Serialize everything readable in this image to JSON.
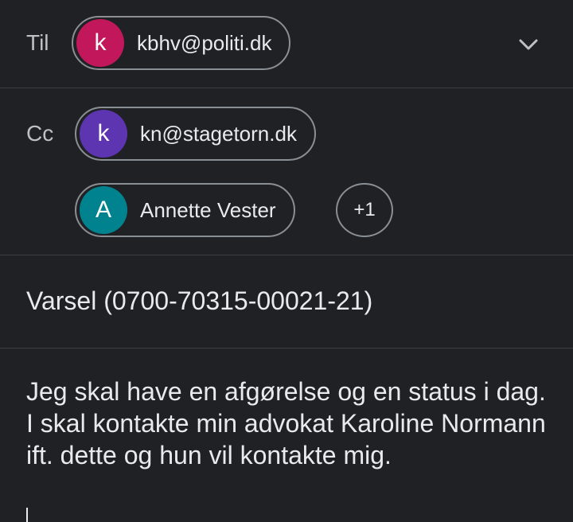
{
  "to": {
    "label": "Til",
    "recipients": [
      {
        "initial": "k",
        "text": "kbhv@politi.dk",
        "color": "#c2185b"
      }
    ]
  },
  "cc": {
    "label": "Cc",
    "recipients": [
      {
        "initial": "k",
        "text": "kn@stagetorn.dk",
        "color": "#5e35b1"
      },
      {
        "initial": "A",
        "text": "Annette Vester",
        "color": "#00838f"
      }
    ],
    "more": "+1"
  },
  "expand_icon": "chevron-down-icon",
  "subject": "Varsel (0700-70315-00021-21)",
  "body": "Jeg skal have en afgørelse og en status i dag. I skal kontakte min advokat Karoline Normann ift. dette og hun vil kontakte mig."
}
